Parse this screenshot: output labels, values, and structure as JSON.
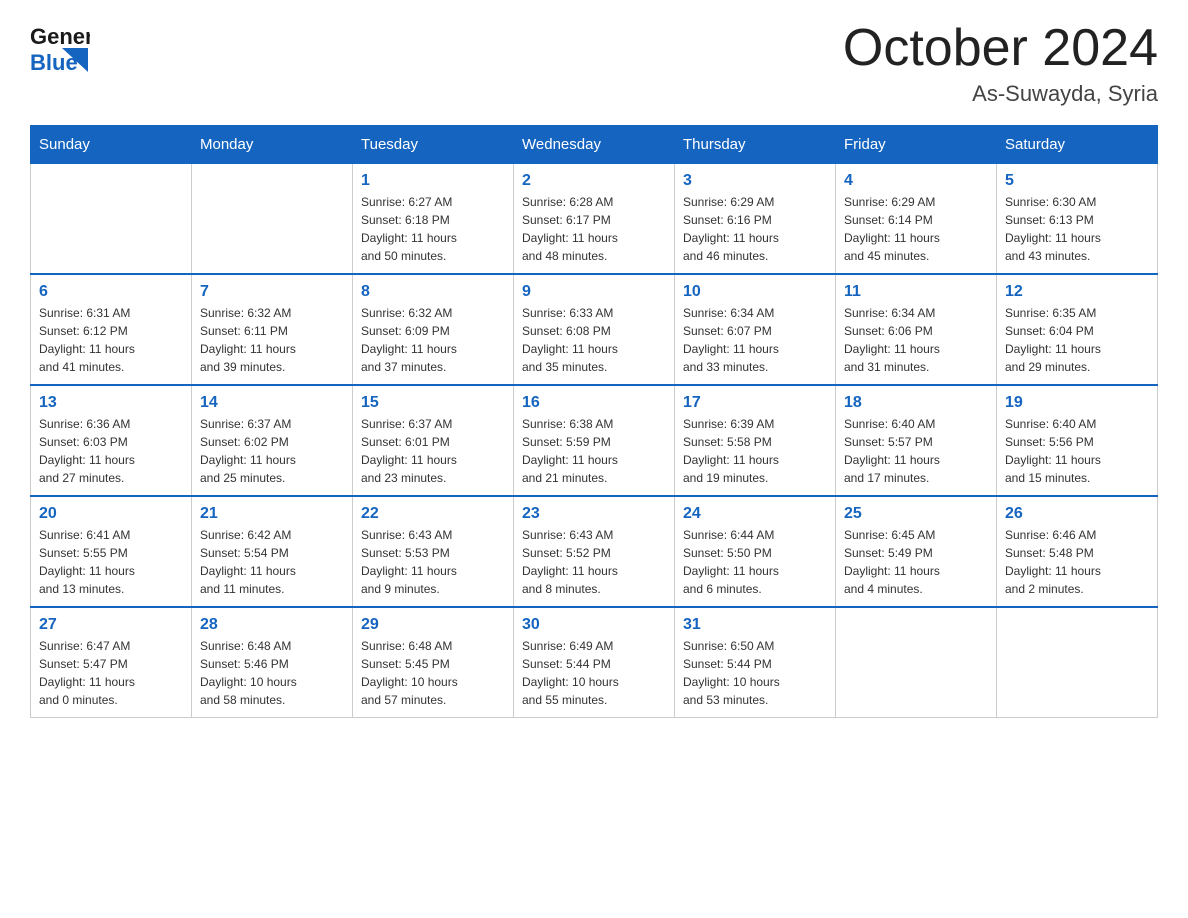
{
  "header": {
    "logo_text_black": "General",
    "logo_text_blue": "Blue",
    "month_year": "October 2024",
    "location": "As-Suwayda, Syria"
  },
  "days_of_week": [
    "Sunday",
    "Monday",
    "Tuesday",
    "Wednesday",
    "Thursday",
    "Friday",
    "Saturday"
  ],
  "weeks": [
    [
      {
        "day": "",
        "info": ""
      },
      {
        "day": "",
        "info": ""
      },
      {
        "day": "1",
        "info": "Sunrise: 6:27 AM\nSunset: 6:18 PM\nDaylight: 11 hours\nand 50 minutes."
      },
      {
        "day": "2",
        "info": "Sunrise: 6:28 AM\nSunset: 6:17 PM\nDaylight: 11 hours\nand 48 minutes."
      },
      {
        "day": "3",
        "info": "Sunrise: 6:29 AM\nSunset: 6:16 PM\nDaylight: 11 hours\nand 46 minutes."
      },
      {
        "day": "4",
        "info": "Sunrise: 6:29 AM\nSunset: 6:14 PM\nDaylight: 11 hours\nand 45 minutes."
      },
      {
        "day": "5",
        "info": "Sunrise: 6:30 AM\nSunset: 6:13 PM\nDaylight: 11 hours\nand 43 minutes."
      }
    ],
    [
      {
        "day": "6",
        "info": "Sunrise: 6:31 AM\nSunset: 6:12 PM\nDaylight: 11 hours\nand 41 minutes."
      },
      {
        "day": "7",
        "info": "Sunrise: 6:32 AM\nSunset: 6:11 PM\nDaylight: 11 hours\nand 39 minutes."
      },
      {
        "day": "8",
        "info": "Sunrise: 6:32 AM\nSunset: 6:09 PM\nDaylight: 11 hours\nand 37 minutes."
      },
      {
        "day": "9",
        "info": "Sunrise: 6:33 AM\nSunset: 6:08 PM\nDaylight: 11 hours\nand 35 minutes."
      },
      {
        "day": "10",
        "info": "Sunrise: 6:34 AM\nSunset: 6:07 PM\nDaylight: 11 hours\nand 33 minutes."
      },
      {
        "day": "11",
        "info": "Sunrise: 6:34 AM\nSunset: 6:06 PM\nDaylight: 11 hours\nand 31 minutes."
      },
      {
        "day": "12",
        "info": "Sunrise: 6:35 AM\nSunset: 6:04 PM\nDaylight: 11 hours\nand 29 minutes."
      }
    ],
    [
      {
        "day": "13",
        "info": "Sunrise: 6:36 AM\nSunset: 6:03 PM\nDaylight: 11 hours\nand 27 minutes."
      },
      {
        "day": "14",
        "info": "Sunrise: 6:37 AM\nSunset: 6:02 PM\nDaylight: 11 hours\nand 25 minutes."
      },
      {
        "day": "15",
        "info": "Sunrise: 6:37 AM\nSunset: 6:01 PM\nDaylight: 11 hours\nand 23 minutes."
      },
      {
        "day": "16",
        "info": "Sunrise: 6:38 AM\nSunset: 5:59 PM\nDaylight: 11 hours\nand 21 minutes."
      },
      {
        "day": "17",
        "info": "Sunrise: 6:39 AM\nSunset: 5:58 PM\nDaylight: 11 hours\nand 19 minutes."
      },
      {
        "day": "18",
        "info": "Sunrise: 6:40 AM\nSunset: 5:57 PM\nDaylight: 11 hours\nand 17 minutes."
      },
      {
        "day": "19",
        "info": "Sunrise: 6:40 AM\nSunset: 5:56 PM\nDaylight: 11 hours\nand 15 minutes."
      }
    ],
    [
      {
        "day": "20",
        "info": "Sunrise: 6:41 AM\nSunset: 5:55 PM\nDaylight: 11 hours\nand 13 minutes."
      },
      {
        "day": "21",
        "info": "Sunrise: 6:42 AM\nSunset: 5:54 PM\nDaylight: 11 hours\nand 11 minutes."
      },
      {
        "day": "22",
        "info": "Sunrise: 6:43 AM\nSunset: 5:53 PM\nDaylight: 11 hours\nand 9 minutes."
      },
      {
        "day": "23",
        "info": "Sunrise: 6:43 AM\nSunset: 5:52 PM\nDaylight: 11 hours\nand 8 minutes."
      },
      {
        "day": "24",
        "info": "Sunrise: 6:44 AM\nSunset: 5:50 PM\nDaylight: 11 hours\nand 6 minutes."
      },
      {
        "day": "25",
        "info": "Sunrise: 6:45 AM\nSunset: 5:49 PM\nDaylight: 11 hours\nand 4 minutes."
      },
      {
        "day": "26",
        "info": "Sunrise: 6:46 AM\nSunset: 5:48 PM\nDaylight: 11 hours\nand 2 minutes."
      }
    ],
    [
      {
        "day": "27",
        "info": "Sunrise: 6:47 AM\nSunset: 5:47 PM\nDaylight: 11 hours\nand 0 minutes."
      },
      {
        "day": "28",
        "info": "Sunrise: 6:48 AM\nSunset: 5:46 PM\nDaylight: 10 hours\nand 58 minutes."
      },
      {
        "day": "29",
        "info": "Sunrise: 6:48 AM\nSunset: 5:45 PM\nDaylight: 10 hours\nand 57 minutes."
      },
      {
        "day": "30",
        "info": "Sunrise: 6:49 AM\nSunset: 5:44 PM\nDaylight: 10 hours\nand 55 minutes."
      },
      {
        "day": "31",
        "info": "Sunrise: 6:50 AM\nSunset: 5:44 PM\nDaylight: 10 hours\nand 53 minutes."
      },
      {
        "day": "",
        "info": ""
      },
      {
        "day": "",
        "info": ""
      }
    ]
  ]
}
